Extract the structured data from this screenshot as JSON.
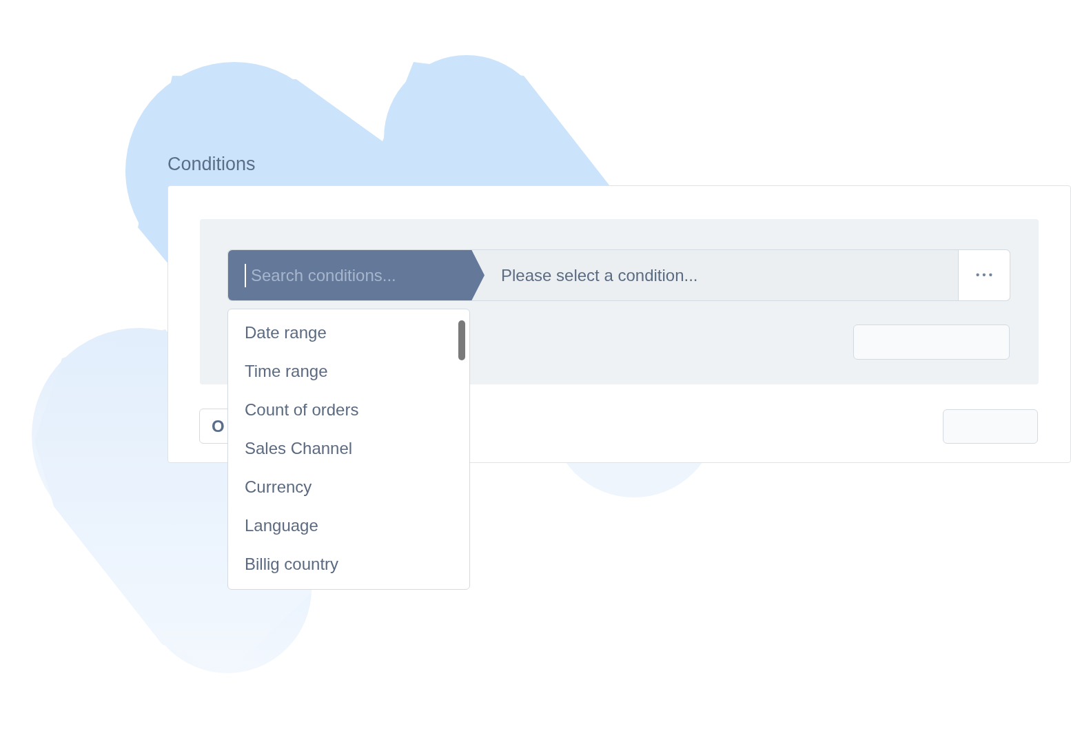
{
  "title": "Conditions",
  "search": {
    "placeholder": "Search conditions..."
  },
  "condition_field": {
    "placeholder": "Please select a condition..."
  },
  "more_button": {
    "label": "• • •"
  },
  "dropdown": {
    "items": [
      {
        "label": "Date range"
      },
      {
        "label": "Time range"
      },
      {
        "label": "Count of orders"
      },
      {
        "label": "Sales Channel"
      },
      {
        "label": "Currency"
      },
      {
        "label": "Language"
      },
      {
        "label": "Billig country"
      }
    ]
  },
  "or_button": {
    "label": "O"
  }
}
